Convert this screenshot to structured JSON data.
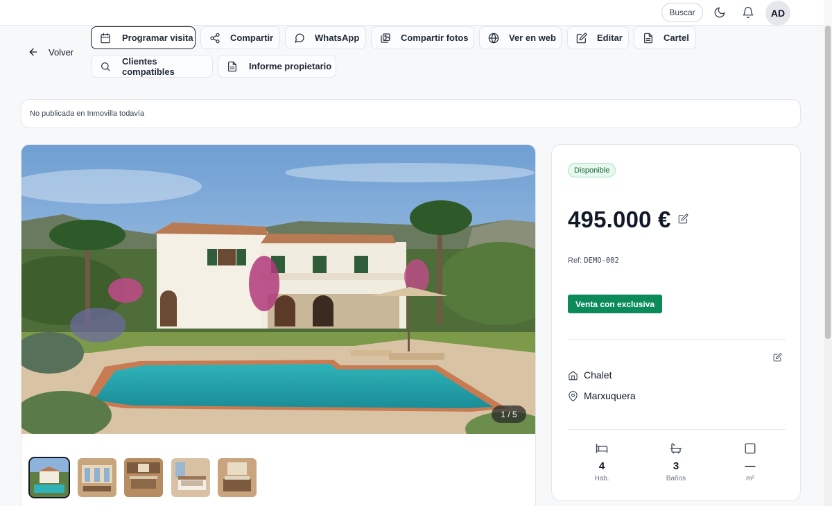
{
  "header": {
    "search_label": "Buscar",
    "avatar_initials": "AD"
  },
  "toolbar": {
    "back_label": "Volver",
    "buttons": [
      {
        "label": "Programar visita",
        "icon": "calendar-icon"
      },
      {
        "label": "Compartir",
        "icon": "share-icon"
      },
      {
        "label": "WhatsApp",
        "icon": "chat-icon"
      },
      {
        "label": "Compartir fotos",
        "icon": "images-icon"
      },
      {
        "label": "Ver en web",
        "icon": "globe-icon"
      },
      {
        "label": "Editar",
        "icon": "edit-icon"
      },
      {
        "label": "Cartel",
        "icon": "document-icon"
      },
      {
        "label": "Clientes compatibles",
        "icon": "search-icon"
      },
      {
        "label": "Informe propietario",
        "icon": "document-icon"
      }
    ]
  },
  "notice": {
    "text": "No publicada en Inmovilla todavía"
  },
  "gallery": {
    "counter": "1 / 5",
    "thumbnails": [
      "exterior-pool",
      "terrace",
      "kitchen",
      "bedroom",
      "bathroom"
    ]
  },
  "property": {
    "status": "Disponible",
    "price": "495.000 €",
    "ref_label": "Ref:",
    "ref_code": "DEMO-002",
    "exclusive_label": "Venta con exclusiva",
    "type": "Chalet",
    "location": "Marxuquera",
    "stats": [
      {
        "value": "4",
        "label": "Hab.",
        "icon": "bed-icon"
      },
      {
        "value": "3",
        "label": "Baños",
        "icon": "bath-icon"
      },
      {
        "value": "—",
        "label": "m²",
        "icon": "square-icon"
      }
    ]
  },
  "colors": {
    "accent_green": "#0b8a5a",
    "status_badge_bg": "#e7f8ee",
    "text_primary": "#111827"
  }
}
